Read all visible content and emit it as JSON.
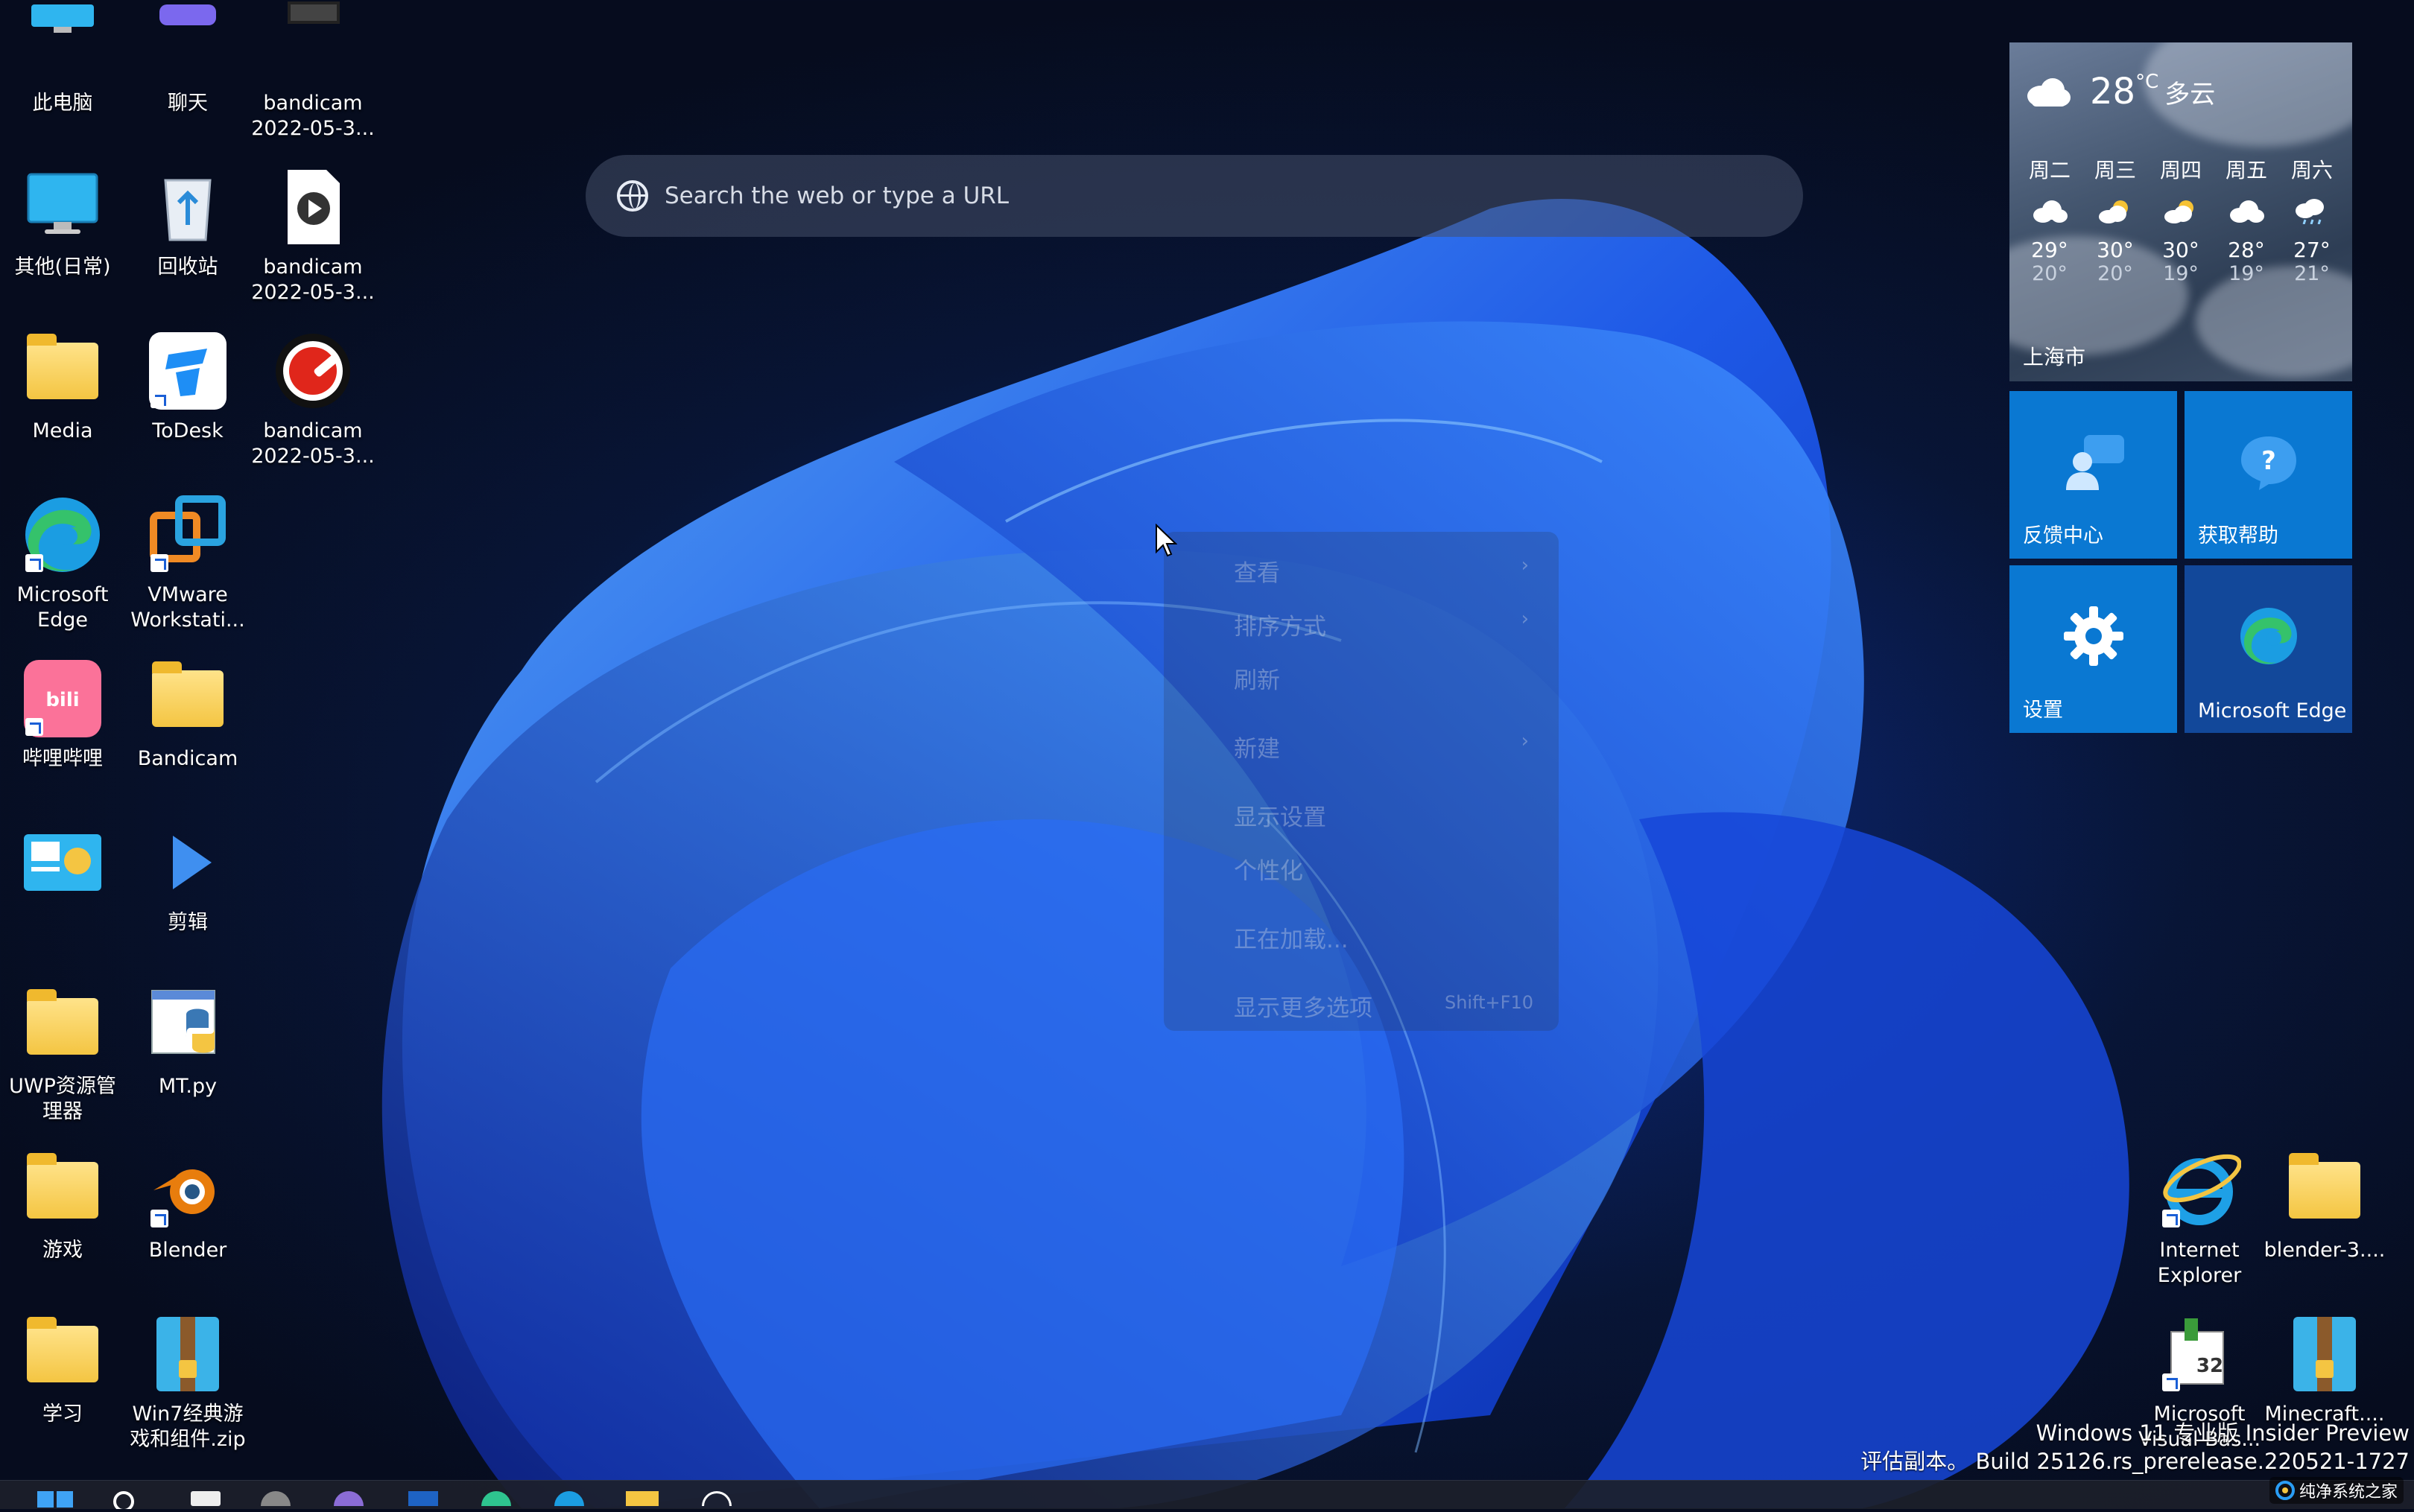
{
  "desktop": {
    "icons_left": [
      {
        "name": "此电脑",
        "kind": "pc"
      },
      {
        "name": "聊天",
        "kind": "chat"
      },
      {
        "name": "bandicam\n2022-05-3...",
        "kind": "video"
      },
      {
        "name": "其他(日常)",
        "kind": "monitor"
      },
      {
        "name": "回收站",
        "kind": "recycle"
      },
      {
        "name": "bandicam\n2022-05-3...",
        "kind": "mediafile"
      },
      {
        "name": "Media",
        "kind": "folder"
      },
      {
        "name": "ToDesk",
        "kind": "todesk"
      },
      {
        "name": "bandicam\n2022-05-3...",
        "kind": "bandicam"
      },
      {
        "name": "Microsoft\nEdge",
        "kind": "edge"
      },
      {
        "name": "VMware\nWorkstati...",
        "kind": "vmware"
      },
      {
        "name": "哔哩哔哩",
        "kind": "bilibili"
      },
      {
        "name": "Bandicam",
        "kind": "folder"
      },
      {
        "name": "",
        "kind": "dashboard"
      },
      {
        "name": "剪辑",
        "kind": "play"
      },
      {
        "name": "UWP资源管\n理器",
        "kind": "folder"
      },
      {
        "name": "MT.py",
        "kind": "python"
      },
      {
        "name": "游戏",
        "kind": "folder"
      },
      {
        "name": "Blender",
        "kind": "blender"
      },
      {
        "name": "学习",
        "kind": "folder"
      },
      {
        "name": "Win7经典游\n戏和组件.zip",
        "kind": "zip"
      }
    ],
    "icons_right": [
      {
        "name": "Internet\nExplorer",
        "kind": "ie"
      },
      {
        "name": "blender-3....",
        "kind": "folder"
      },
      {
        "name": "Microsoft\nVisual Bas...",
        "kind": "vb"
      },
      {
        "name": "Minecraft....",
        "kind": "zip"
      }
    ]
  },
  "search": {
    "placeholder": "Search the web or type a URL"
  },
  "weather": {
    "temp": "28",
    "unit": "°C",
    "condition": "多云",
    "city": "上海市",
    "days": [
      {
        "day": "周二",
        "high": "29°",
        "low": "20°",
        "icon": "cloud-icon"
      },
      {
        "day": "周三",
        "high": "30°",
        "low": "20°",
        "icon": "partly-sunny-icon"
      },
      {
        "day": "周四",
        "high": "30°",
        "low": "19°",
        "icon": "partly-sunny-icon"
      },
      {
        "day": "周五",
        "high": "28°",
        "low": "19°",
        "icon": "cloud-icon"
      },
      {
        "day": "周六",
        "high": "27°",
        "low": "21°",
        "icon": "rain-icon"
      }
    ]
  },
  "tiles": {
    "feedback": "反馈中心",
    "help": "获取帮助",
    "settings": "设置",
    "edge": "Microsoft Edge"
  },
  "context_menu": {
    "items": [
      {
        "label": "查看",
        "arrow": true
      },
      {
        "label": "排序方式",
        "arrow": true
      },
      {
        "label": "刷新",
        "arrow": false
      },
      {
        "label": "新建",
        "arrow": true
      },
      {
        "label": "显示设置",
        "arrow": false
      },
      {
        "label": "个性化",
        "arrow": false
      },
      {
        "label": "正在加载...",
        "arrow": false
      },
      {
        "label": "显示更多选项",
        "arrow": false,
        "shortcut": "Shift+F10"
      }
    ]
  },
  "watermark": {
    "line1": "Windows 11 专业版 Insider Preview",
    "line2": "评估副本。 Build 25126.rs_prerelease.220521-1727"
  },
  "site_logo": "纯净系统之家",
  "colors": {
    "tile": "#0a78d2",
    "accent": "#1a5fd6"
  }
}
